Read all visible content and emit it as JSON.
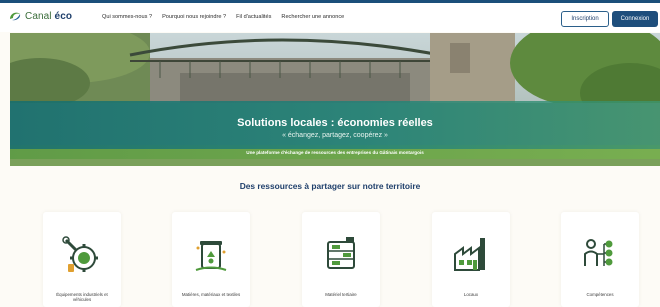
{
  "brand": {
    "name_part1": "Canal",
    "name_part2": "éco"
  },
  "nav": {
    "links": [
      "Qui sommes-nous ?",
      "Pourquoi nous rejoindre ?",
      "Fil d'actualités",
      "Rechercher une annonce"
    ],
    "signup_label": "Inscription",
    "login_label": "Connexion"
  },
  "hero": {
    "title": "Solutions locales : économies réelles",
    "subtitle": "« échangez, partagez, coopérez »",
    "strip_text": "Une plateforme d'échange de ressources des entreprises du Gâtinais montargois"
  },
  "resources": {
    "title": "Des ressources à partager sur notre territoire",
    "cards": [
      {
        "label": "Équipements industriels et véhicules",
        "icon": "gear-wrench-icon"
      },
      {
        "label": "Matières, matériaux et textiles",
        "icon": "recycling-bin-icon"
      },
      {
        "label": "Matériel tertiaire",
        "icon": "office-equipment-icon"
      },
      {
        "label": "Locaux",
        "icon": "factory-building-icon"
      },
      {
        "label": "Compétences",
        "icon": "person-network-icon"
      }
    ]
  },
  "colors": {
    "navy": "#1e4e7c",
    "teal_band": "#1e8278",
    "green_strip": "#6aa34a",
    "icon_green": "#4f9a3c"
  }
}
